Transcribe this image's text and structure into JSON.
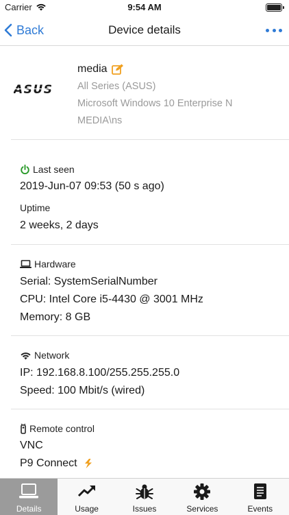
{
  "status_bar": {
    "carrier": "Carrier",
    "time": "9:54 AM"
  },
  "nav": {
    "back_label": "Back",
    "title": "Device details"
  },
  "device": {
    "name": "media",
    "model": "All Series (ASUS)",
    "os": "Microsoft Windows 10 Enterprise N",
    "user": "MEDIA\\ns",
    "logo_text": "ASUS"
  },
  "last_seen": {
    "label": "Last seen",
    "value": "2019-Jun-07 09:53 (50 s ago)"
  },
  "uptime": {
    "label": "Uptime",
    "value": "2 weeks, 2 days"
  },
  "hardware": {
    "label": "Hardware",
    "serial": "Serial: SystemSerialNumber",
    "cpu": "CPU: Intel Core i5-4430 @ 3001 MHz",
    "memory": "Memory: 8 GB"
  },
  "network": {
    "label": "Network",
    "ip": "IP: 192.168.8.100/255.255.255.0",
    "speed": "Speed: 100 Mbit/s (wired)"
  },
  "remote": {
    "label": "Remote control",
    "items": [
      "VNC",
      "P9 Connect"
    ]
  },
  "tabs": [
    {
      "label": "Details",
      "icon": "laptop-icon",
      "active": true
    },
    {
      "label": "Usage",
      "icon": "trend-icon",
      "active": false
    },
    {
      "label": "Issues",
      "icon": "bug-icon",
      "active": false
    },
    {
      "label": "Services",
      "icon": "gear-icon",
      "active": false
    },
    {
      "label": "Events",
      "icon": "log-icon",
      "active": false
    }
  ],
  "colors": {
    "accent": "#2f7bd6",
    "edit": "#f0a020",
    "power": "#2a9a2a",
    "tab_active": "#9b9b9b"
  }
}
